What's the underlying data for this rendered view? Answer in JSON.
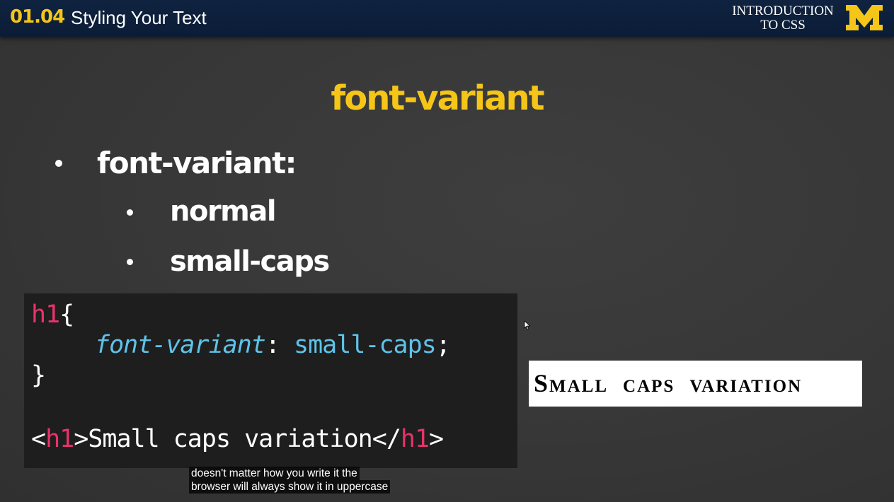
{
  "header": {
    "lesson_number": "01.04",
    "lesson_title": "Styling Your Text",
    "course_line1": "INTRODUCTION",
    "course_line2": "TO CSS",
    "logo_letter": "M"
  },
  "slide": {
    "title": "font-variant",
    "bullet_main": "font-variant:",
    "sub_bullets": [
      "normal",
      "small-caps"
    ]
  },
  "code": {
    "line1_tag": "h1",
    "line1_brace": "{",
    "line2_prop": "font-variant",
    "line2_colon": ":",
    "line2_value": "small-caps",
    "line2_semicolon": ";",
    "line3_brace": "}",
    "line5_open_lt": "<",
    "line5_open_tag": "h1",
    "line5_content": ">Small caps variation</",
    "line5_close_tag": "h1",
    "line5_close_gt": ">"
  },
  "demo": {
    "text": "Small caps variation"
  },
  "captions": {
    "line1": "doesn't matter how you write it the",
    "line2": "browser will always show it in uppercase"
  },
  "colors": {
    "accent_yellow": "#f5c518",
    "header_navy": "#0f2340",
    "code_tag_pink": "#e8336b",
    "code_prop_cyan": "#5ec3e8",
    "slide_background": "#383838"
  },
  "icons": {
    "pointer": "mouse-pointer-icon",
    "logo": "block-m-logo"
  }
}
